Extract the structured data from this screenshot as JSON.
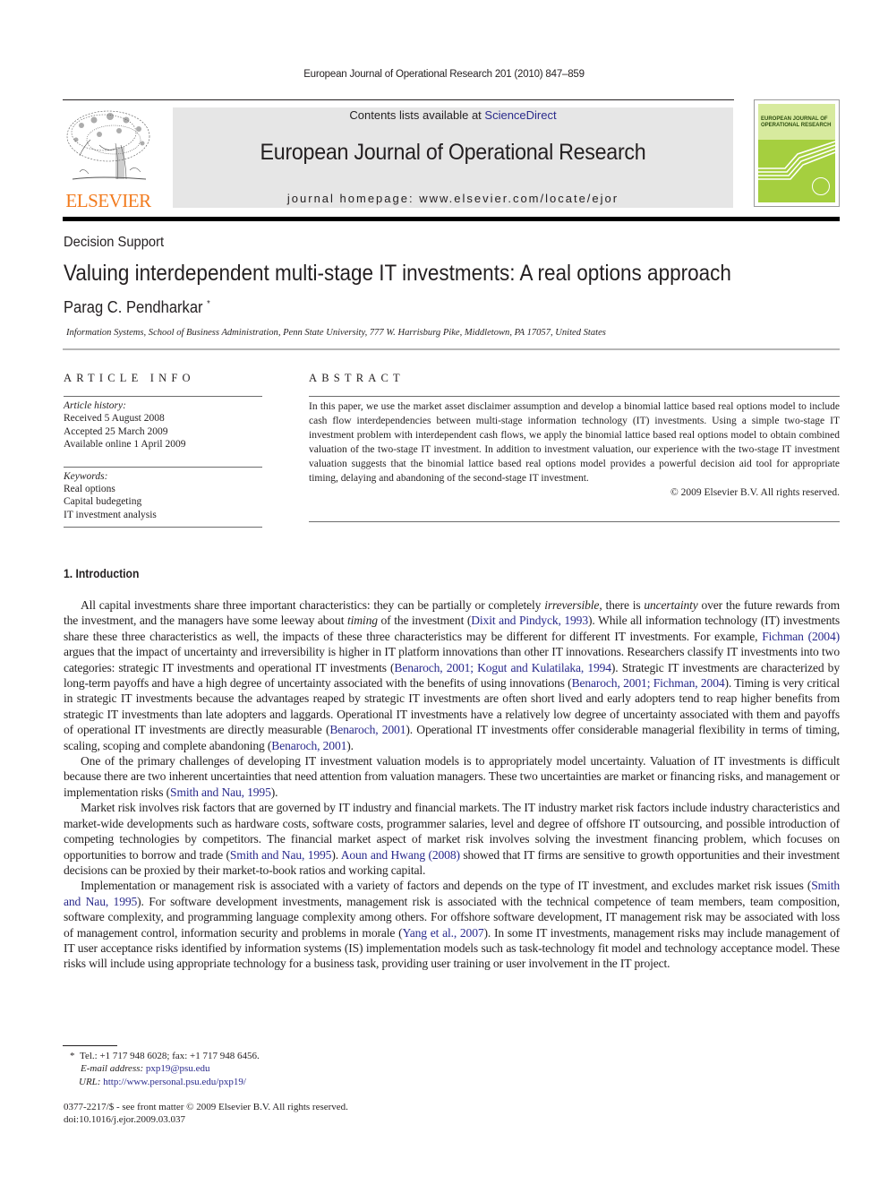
{
  "running_head": "European Journal of Operational Research 201 (2010) 847–859",
  "header": {
    "publisher_logo_text": "ELSEVIER",
    "contents_prefix": "Contents lists available at ",
    "contents_link": "ScienceDirect",
    "journal_title": "European Journal of Operational Research",
    "homepage": "journal homepage: www.elsevier.com/locate/ejor",
    "cover_title_line1": "EUROPEAN JOURNAL OF",
    "cover_title_line2": "OPERATIONAL RESEARCH",
    "colors": {
      "elsevier_orange": "#f27b1e",
      "cover_green": "#a5cf3f",
      "banner_gray": "#e6e6e6",
      "link_blue": "#2a2a8c"
    }
  },
  "article": {
    "section": "Decision Support",
    "title": "Valuing interdependent multi-stage IT investments: A real options approach",
    "author": "Parag C. Pendharkar",
    "author_mark": "*",
    "affiliation": "Information Systems, School of Business Administration, Penn State University, 777 W. Harrisburg Pike, Middletown, PA 17057, United States"
  },
  "article_info": {
    "heading": "ARTICLE INFO",
    "history_label": "Article history:",
    "history": [
      "Received 5 August 2008",
      "Accepted 25 March 2009",
      "Available online 1 April 2009"
    ],
    "keywords_label": "Keywords:",
    "keywords": [
      "Real options",
      "Capital budegeting",
      "IT investment analysis"
    ]
  },
  "abstract": {
    "heading": "ABSTRACT",
    "text": "In this paper, we use the market asset disclaimer assumption and develop a binomial lattice based real options model to include cash flow interdependencies between multi-stage information technology (IT) investments. Using a simple two-stage IT investment problem with interdependent cash flows, we apply the binomial lattice based real options model to obtain combined valuation of the two-stage IT investment. In addition to investment valuation, our experience with the two-stage IT investment valuation suggests that the binomial lattice based real options model provides a powerful decision aid tool for appropriate timing, delaying and abandoning of the second-stage IT investment.",
    "copyright": "© 2009 Elsevier B.V. All rights reserved."
  },
  "introduction": {
    "heading": "1. Introduction",
    "p1": {
      "t1": "All capital investments share three important characteristics: they can be partially or completely ",
      "i1": "irreversible",
      "t2": ", there is ",
      "i2": "uncertainty",
      "t3": " over the future rewards from the investment, and the managers have some leeway about ",
      "i3": "timing",
      "t4": " of the investment (",
      "c1": "Dixit and Pindyck, 1993",
      "t5": "). While all information technology (IT) investments share these three characteristics as well, the impacts of these three characteristics may be different for different IT investments. For example, ",
      "c2": "Fichman (2004)",
      "t6": " argues that the impact of uncertainty and irreversibility is higher in IT platform innovations than other IT innovations. Researchers classify IT investments into two categories: strategic IT investments and operational IT investments (",
      "c3": "Benaroch, 2001; Kogut and Kulatilaka, 1994",
      "t7": "). Strategic IT investments are characterized by long-term payoffs and have a high degree of uncertainty associated with the benefits of using innovations (",
      "c4": "Benaroch, 2001; Fichman, 2004",
      "t8": "). Timing is very critical in strategic IT investments because the advantages reaped by strategic IT investments are often short lived and early adopters tend to reap higher benefits from strategic IT investments than late adopters and laggards. Operational IT investments have a relatively low degree of uncertainty associated with them and payoffs of operational IT investments are directly measurable (",
      "c5": "Benaroch, 2001",
      "t9": "). Operational IT investments offer considerable managerial flexibility in terms of timing, scaling, scoping and complete abandoning (",
      "c6": "Benaroch, 2001",
      "t10": ")."
    },
    "p2": {
      "t1": "One of the primary challenges of developing IT investment valuation models is to appropriately model uncertainty. Valuation of IT investments is difficult because there are two inherent uncertainties that need attention from valuation managers. These two uncertainties are market or financing risks, and management or implementation risks (",
      "c1": "Smith and Nau, 1995",
      "t2": ")."
    },
    "p3": {
      "t1": "Market risk involves risk factors that are governed by IT industry and financial markets. The IT industry market risk factors include industry characteristics and market-wide developments such as hardware costs, software costs, programmer salaries, level and degree of offshore IT outsourcing, and possible introduction of competing technologies by competitors. The financial market aspect of market risk involves solving the investment financing problem, which focuses on opportunities to borrow and trade (",
      "c1": "Smith and Nau, 1995",
      "t2": "). ",
      "c2": "Aoun and Hwang (2008)",
      "t3": " showed that IT firms are sensitive to growth opportunities and their investment decisions can be proxied by their market-to-book ratios and working capital."
    },
    "p4": {
      "t1": "Implementation or management risk is associated with a variety of factors and depends on the type of IT investment, and excludes market risk issues (",
      "c1": "Smith and Nau, 1995",
      "t2": "). For software development investments, management risk is associated with the technical competence of team members, team composition, software complexity, and programming language complexity among others. For offshore software development, IT management risk may be associated with loss of management control, information security and problems in morale (",
      "c2": "Yang et al., 2007",
      "t3": "). In some IT investments, management risks may include management of IT user acceptance risks identified by information systems (IS) implementation models such as task-technology fit model and technology acceptance model. These risks will include using appropriate technology for a business task, providing user training or user involvement in the IT project."
    }
  },
  "footnote": {
    "mark": "*",
    "contact": "Tel.: +1 717 948 6028; fax: +1 717 948 6456.",
    "email_label": "E-mail address:",
    "email": "pxp19@psu.edu",
    "url_label": "URL:",
    "url": "http://www.personal.psu.edu/pxp19/"
  },
  "front_matter": {
    "issn_line": "0377-2217/$ - see front matter © 2009 Elsevier B.V. All rights reserved.",
    "doi": "doi:10.1016/j.ejor.2009.03.037"
  }
}
